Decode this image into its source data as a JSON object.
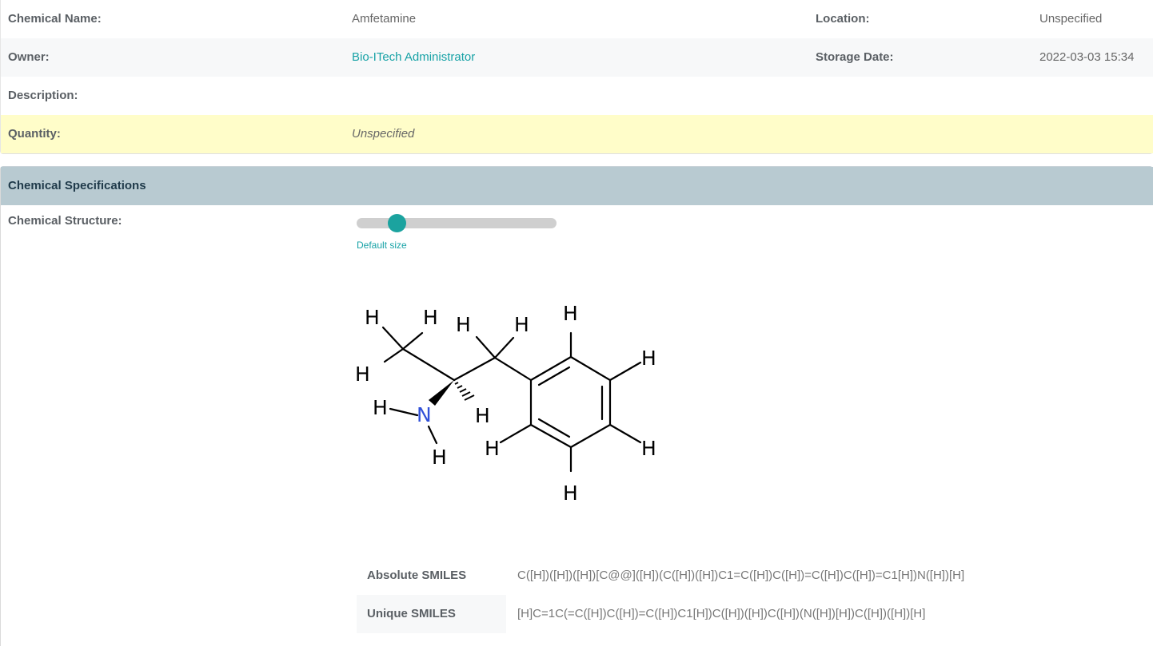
{
  "details": {
    "chemical_name_label": "Chemical Name:",
    "chemical_name": "Amfetamine",
    "location_label": "Location:",
    "location": "Unspecified",
    "owner_label": "Owner:",
    "owner": "Bio-ITech Administrator",
    "storage_date_label": "Storage Date:",
    "storage_date": "2022-03-03 15:34",
    "description_label": "Description:",
    "quantity_label": "Quantity:",
    "quantity": "Unspecified"
  },
  "specifications": {
    "title": "Chemical Specifications",
    "structure_label": "Chemical Structure:",
    "size_slider_level": 0.2,
    "default_size_link": "Default size",
    "atoms": {
      "hydrogen": "H",
      "nitrogen": "N"
    },
    "smiles": [
      {
        "label": "Absolute SMILES",
        "value": "C([H])([H])([H])[C@@]([H])(C([H])([H])C1=C([H])C([H])=C([H])C([H])=C1[H])N([H])[H]"
      },
      {
        "label": "Unique SMILES",
        "value": "[H]C=1C(=C([H])C([H])=C([H])C1[H])C([H])([H])C([H])(N([H])[H])C([H])([H])[H]"
      }
    ]
  },
  "colors": {
    "accent": "#17a2a6",
    "header_bg": "#b8cad1",
    "quantity_bg": "#fffdc9",
    "nitrogen": "#3050d8"
  }
}
